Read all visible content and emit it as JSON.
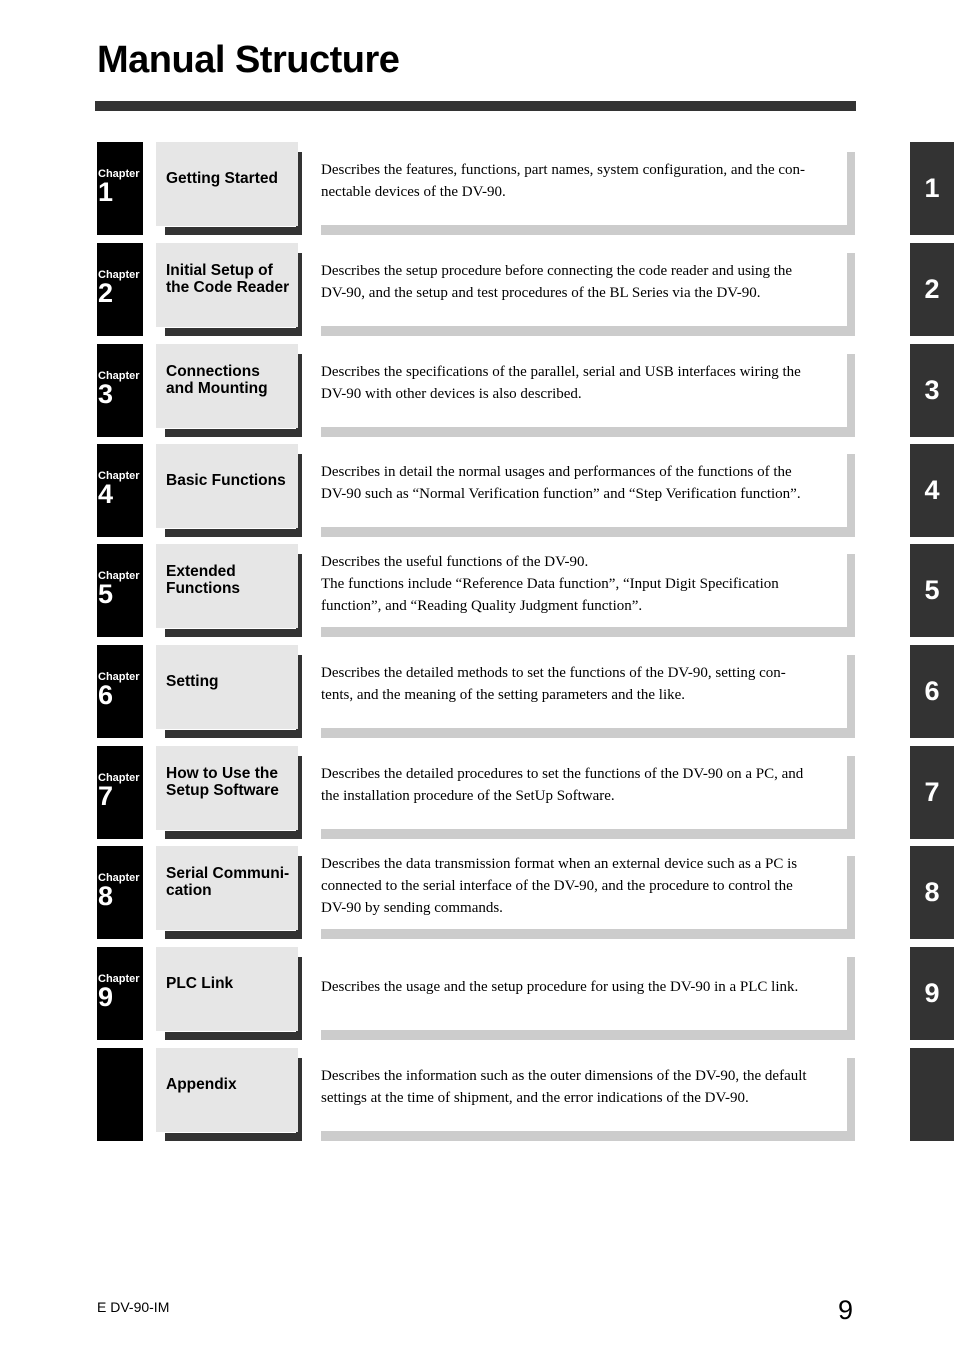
{
  "page": {
    "title": "Manual Structure",
    "footer_code": "E DV-90-IM",
    "page_number": "9"
  },
  "colors": {
    "chapter_box": "#000000",
    "title_box": "#e6e6e6",
    "title_shadow": "#333333",
    "description_border": "#cccccc",
    "side_tab": "#333333"
  },
  "chapters": [
    {
      "chapter_word": "Chapter",
      "number": "1",
      "title": "Getting Started",
      "description": "Describes the features, functions, part names, system configuration, and the con-\nnectable devices of the DV-90.",
      "tab_label": "1"
    },
    {
      "chapter_word": "Chapter",
      "number": "2",
      "title": "Initial Setup of\nthe Code Reader",
      "description": "Describes the setup procedure before connecting the code reader and using the\nDV-90, and the setup and test procedures of the BL Series via the DV-90.",
      "tab_label": "2"
    },
    {
      "chapter_word": "Chapter",
      "number": "3",
      "title": "Connections\nand Mounting",
      "description": "Describes the specifications of the parallel, serial and USB interfaces wiring the\nDV-90 with other devices is also described.",
      "tab_label": "3"
    },
    {
      "chapter_word": "Chapter",
      "number": "4",
      "title": "Basic Functions",
      "description": "Describes in detail the normal usages and performances of the functions of the\nDV-90 such as “Normal Verification function” and “Step Verification function”.",
      "tab_label": "4"
    },
    {
      "chapter_word": "Chapter",
      "number": "5",
      "title": "Extended\nFunctions",
      "description": "Describes the useful functions of the DV-90.\nThe functions include “Reference Data function”, “Input Digit Specification\nfunction”, and “Reading Quality Judgment function”.",
      "tab_label": "5"
    },
    {
      "chapter_word": "Chapter",
      "number": "6",
      "title": "Setting",
      "description": "Describes the detailed methods to set the functions of the DV-90, setting con-\ntents, and the meaning of the setting parameters and the like.",
      "tab_label": "6"
    },
    {
      "chapter_word": "Chapter",
      "number": "7",
      "title": "How to Use the\nSetup Software",
      "description": "Describes the detailed procedures to set the functions of the DV-90 on a PC, and\nthe installation procedure of the SetUp Software.",
      "tab_label": "7"
    },
    {
      "chapter_word": "Chapter",
      "number": "8",
      "title": "Serial Communi-\ncation",
      "description": "Describes the data transmission format when an external device such as a PC is\nconnected to the serial interface of the DV-90, and the procedure to control the\nDV-90 by sending commands.",
      "tab_label": "8"
    },
    {
      "chapter_word": "Chapter",
      "number": "9",
      "title": "PLC Link",
      "description": "Describes the usage and the setup procedure for using the DV-90 in a PLC link.",
      "tab_label": "9"
    },
    {
      "chapter_word": "",
      "number": "",
      "title": "Appendix",
      "description": "Describes the information such as the outer dimensions of the DV-90, the default\nsettings at the time of shipment, and the error indications of the DV-90.",
      "tab_label": ""
    }
  ]
}
